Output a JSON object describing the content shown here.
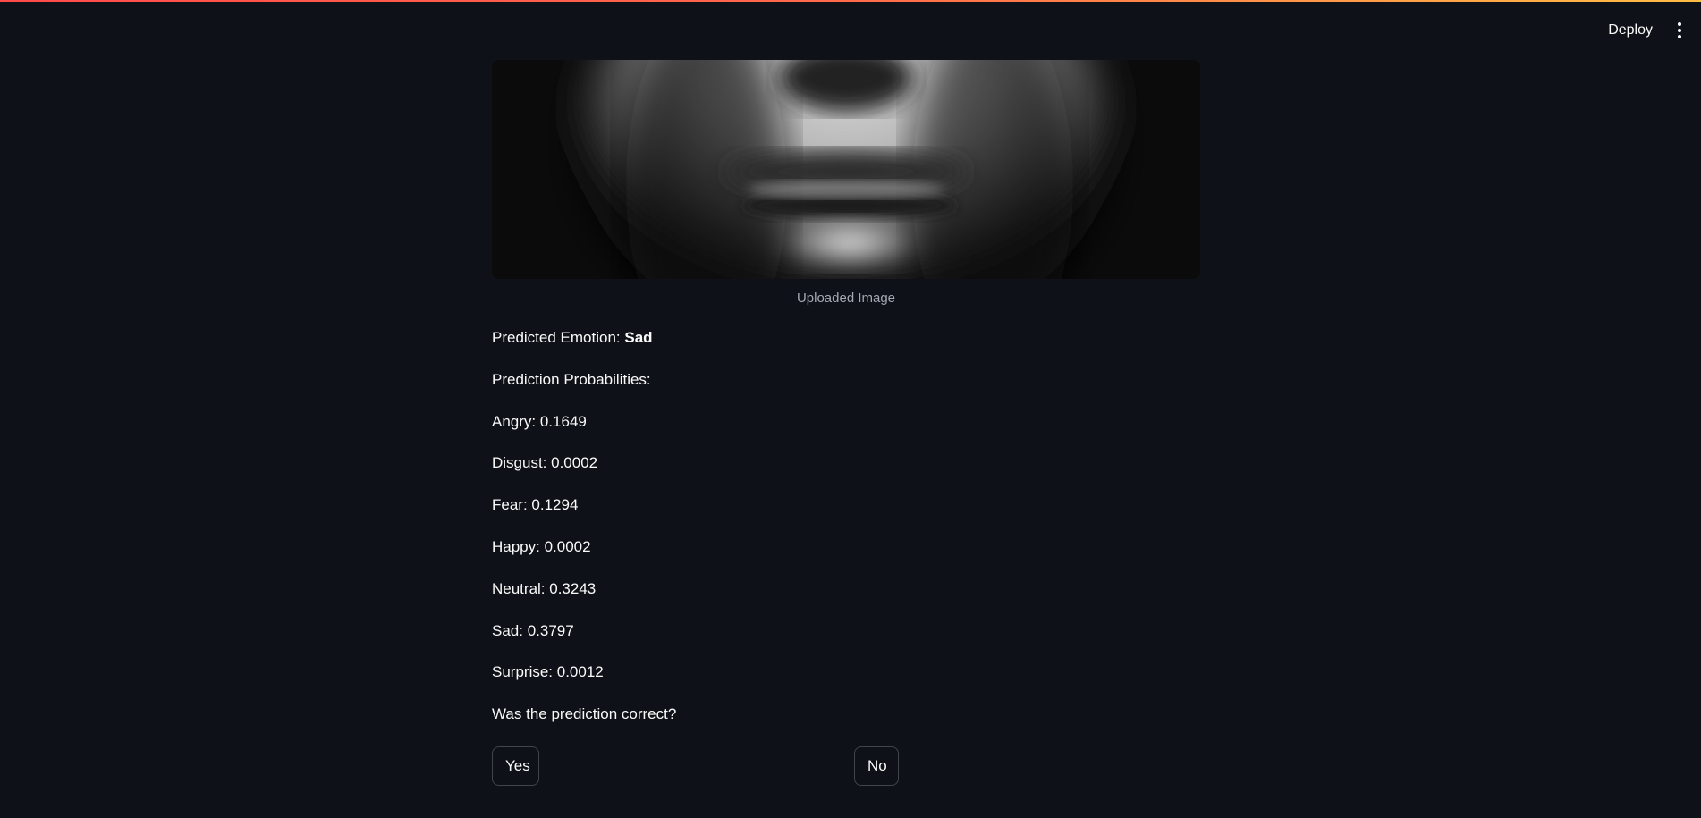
{
  "header": {
    "deploy_label": "Deploy",
    "menu_icon": "vertical-ellipsis-icon"
  },
  "image": {
    "caption": "Uploaded Image"
  },
  "prediction": {
    "label_prefix": "Predicted Emotion: ",
    "emotion": "Sad",
    "probabilities_heading": "Prediction Probabilities:",
    "probabilities": [
      {
        "text": "Angry: 0.1649"
      },
      {
        "text": "Disgust: 0.0002"
      },
      {
        "text": "Fear: 0.1294"
      },
      {
        "text": "Happy: 0.0002"
      },
      {
        "text": "Neutral: 0.3243"
      },
      {
        "text": "Sad: 0.3797"
      },
      {
        "text": "Surprise: 0.0012"
      }
    ]
  },
  "feedback": {
    "question": "Was the prediction correct?",
    "yes_label": "Yes",
    "no_label": "No"
  },
  "colors": {
    "background": "#0e1117",
    "text": "#fafafa",
    "caption": "#a3a8b4",
    "accent": "#ff4b4b"
  }
}
